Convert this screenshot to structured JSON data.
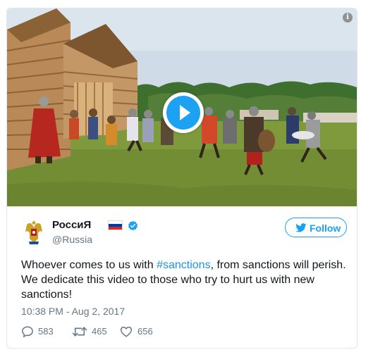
{
  "media": {
    "type": "video",
    "play_label": "Play video"
  },
  "author": {
    "display_name": "РоссиЯ",
    "handle": "@Russia",
    "verified": true
  },
  "follow_button": {
    "label": "Follow"
  },
  "tweet": {
    "text_before": "Whoever comes to us with ",
    "hashtag": "#sanctions",
    "text_after": ", from sanctions will perish. We dedicate this video to those who try to hurt us with new sanctions!",
    "timestamp": "10:38 PM - Aug 2, 2017"
  },
  "actions": {
    "replies": "583",
    "retweets": "465",
    "likes": "656"
  },
  "colors": {
    "accent": "#1da1f2",
    "hashtag": "#1b95e0",
    "muted": "#657786",
    "text": "#14171a",
    "border": "#e1e8ed"
  },
  "icons": {
    "info": "info-icon",
    "play": "play-icon",
    "flag": "russian-flag-icon",
    "verified": "verified-badge-icon",
    "bird": "twitter-bird-icon",
    "reply": "reply-icon",
    "retweet": "retweet-icon",
    "like": "heart-icon"
  }
}
